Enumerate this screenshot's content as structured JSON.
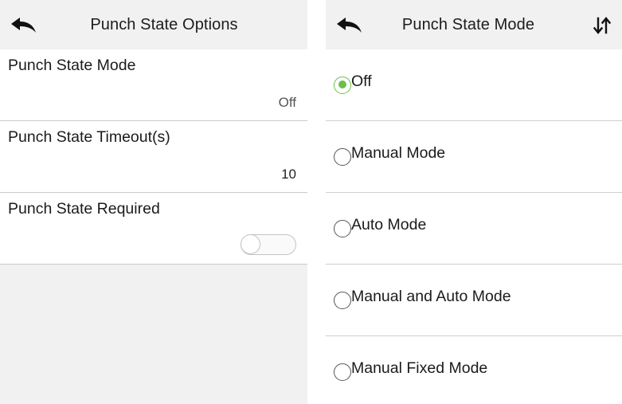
{
  "left_screen": {
    "title": "Punch State Options",
    "settings": [
      {
        "label": "Punch State Mode",
        "value": "Off"
      },
      {
        "label": "Punch State Timeout(s)",
        "value": "10"
      },
      {
        "label": "Punch State Required",
        "toggle_on": false
      }
    ]
  },
  "right_screen": {
    "title": "Punch State Mode",
    "selected_index": 0,
    "options": [
      "Off",
      "Manual Mode",
      "Auto Mode",
      "Manual and Auto Mode",
      "Manual Fixed Mode"
    ]
  },
  "colors": {
    "header_bg": "#f1f1f1",
    "radio_selected": "#6cc04a",
    "divider": "#c9c9c9"
  },
  "icons": [
    "back-arrow-icon",
    "sort-icon"
  ]
}
